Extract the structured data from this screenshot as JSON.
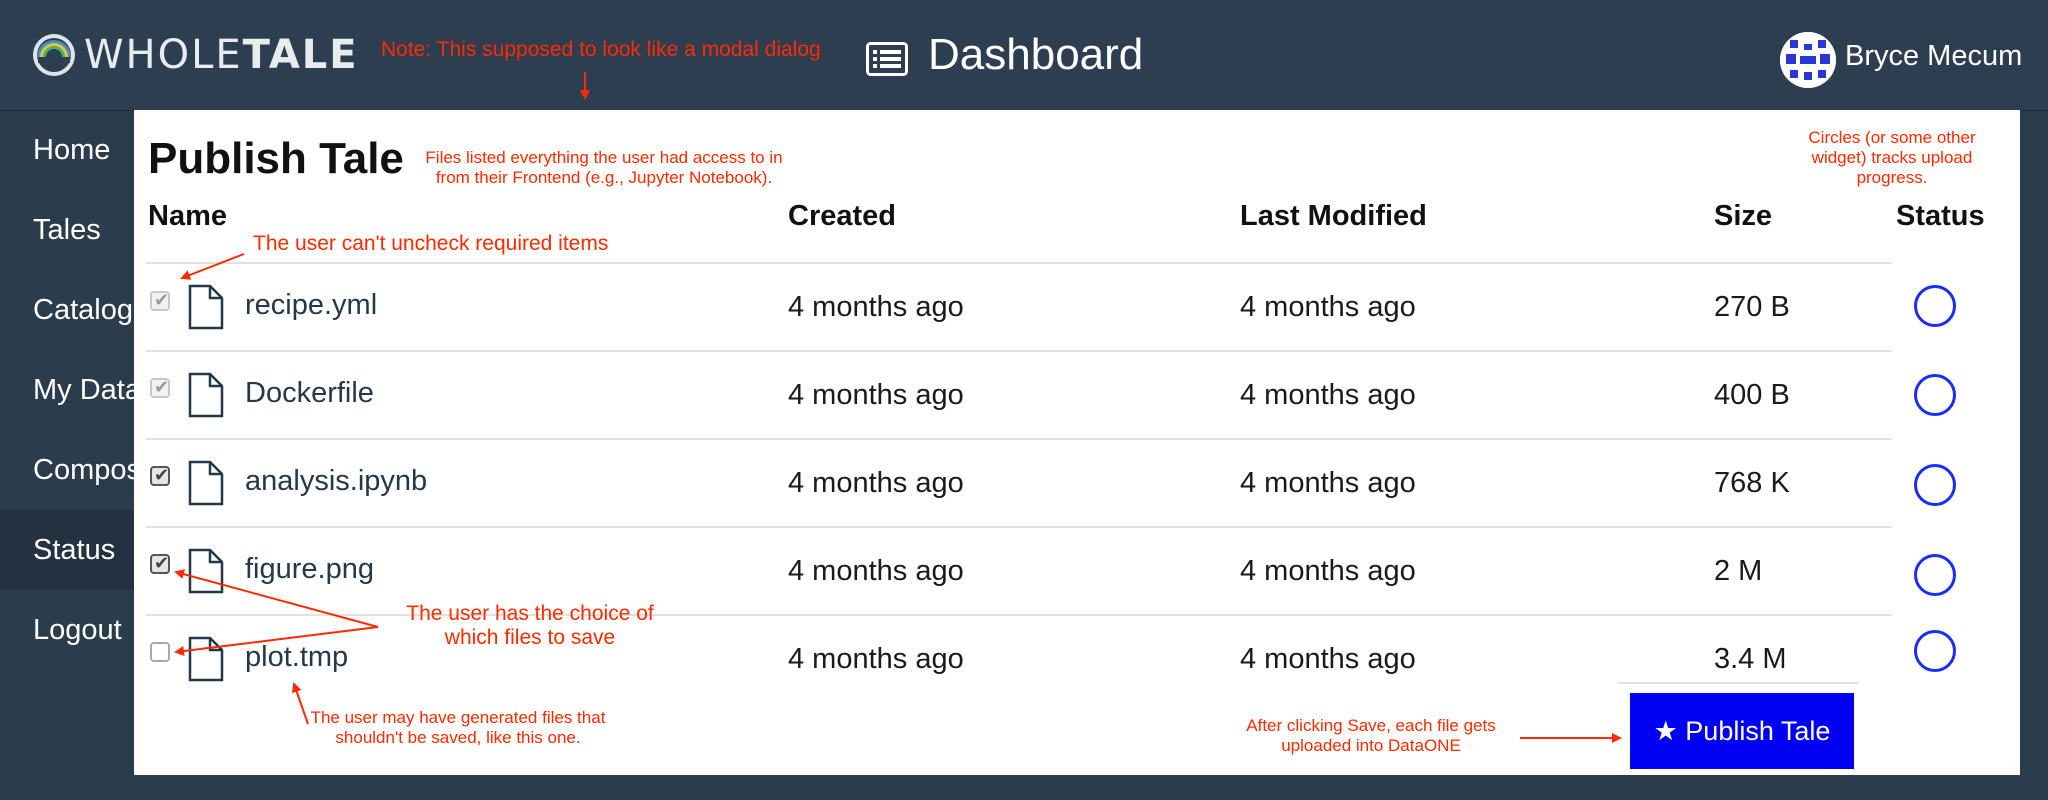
{
  "brand": {
    "name_light": "WHOLE",
    "name_bold": "TALE"
  },
  "header": {
    "title": "Dashboard",
    "user_name": "Bryce Mecum"
  },
  "sidebar": {
    "items": [
      {
        "label": "Home"
      },
      {
        "label": "Tales"
      },
      {
        "label": "Catalog"
      },
      {
        "label": "My Data"
      },
      {
        "label": "Compose"
      },
      {
        "label": "Status"
      },
      {
        "label": "Logout"
      }
    ]
  },
  "modal": {
    "title": "Publish Tale",
    "columns": {
      "name": "Name",
      "created": "Created",
      "modified": "Last Modified",
      "size": "Size",
      "status": "Status"
    },
    "files": [
      {
        "name": "recipe.yml",
        "created": "4 months ago",
        "modified": "4 months ago",
        "size": "270 B",
        "checked": true,
        "required": true
      },
      {
        "name": "Dockerfile",
        "created": "4 months ago",
        "modified": "4 months ago",
        "size": "400 B",
        "checked": true,
        "required": true
      },
      {
        "name": "analysis.ipynb",
        "created": "4 months ago",
        "modified": "4 months ago",
        "size": "768 K",
        "checked": true,
        "required": false
      },
      {
        "name": "figure.png",
        "created": "4 months ago",
        "modified": "4 months ago",
        "size": "2 M",
        "checked": true,
        "required": false
      },
      {
        "name": "plot.tmp",
        "created": "4 months ago",
        "modified": "4 months ago",
        "size": "3.4 M",
        "checked": false,
        "required": false
      }
    ],
    "publish_button": "★ Publish Tale"
  },
  "annotations": {
    "modal_note": "Note: This supposed to look like a modal dialog",
    "files_note": [
      "Files listed everything the user had access to in",
      "from their Frontend (e.g., Jupyter Notebook)."
    ],
    "circles_note": [
      "Circles (or some other",
      "widget) tracks upload",
      "progress."
    ],
    "required_note": "The user can't uncheck required items",
    "choice_note": [
      "The user has the choice of",
      "which files to save"
    ],
    "generated_note": [
      "The user may have generated files that",
      "shouldn't be saved, like this one."
    ],
    "save_note": [
      "After clicking Save, each file gets",
      "uploaded into DataONE"
    ]
  },
  "colors": {
    "navbar": "#2c3e50",
    "annotation": "#ff2a00",
    "publish_button": "#0000f5",
    "status_circle": "#1a2dff"
  }
}
